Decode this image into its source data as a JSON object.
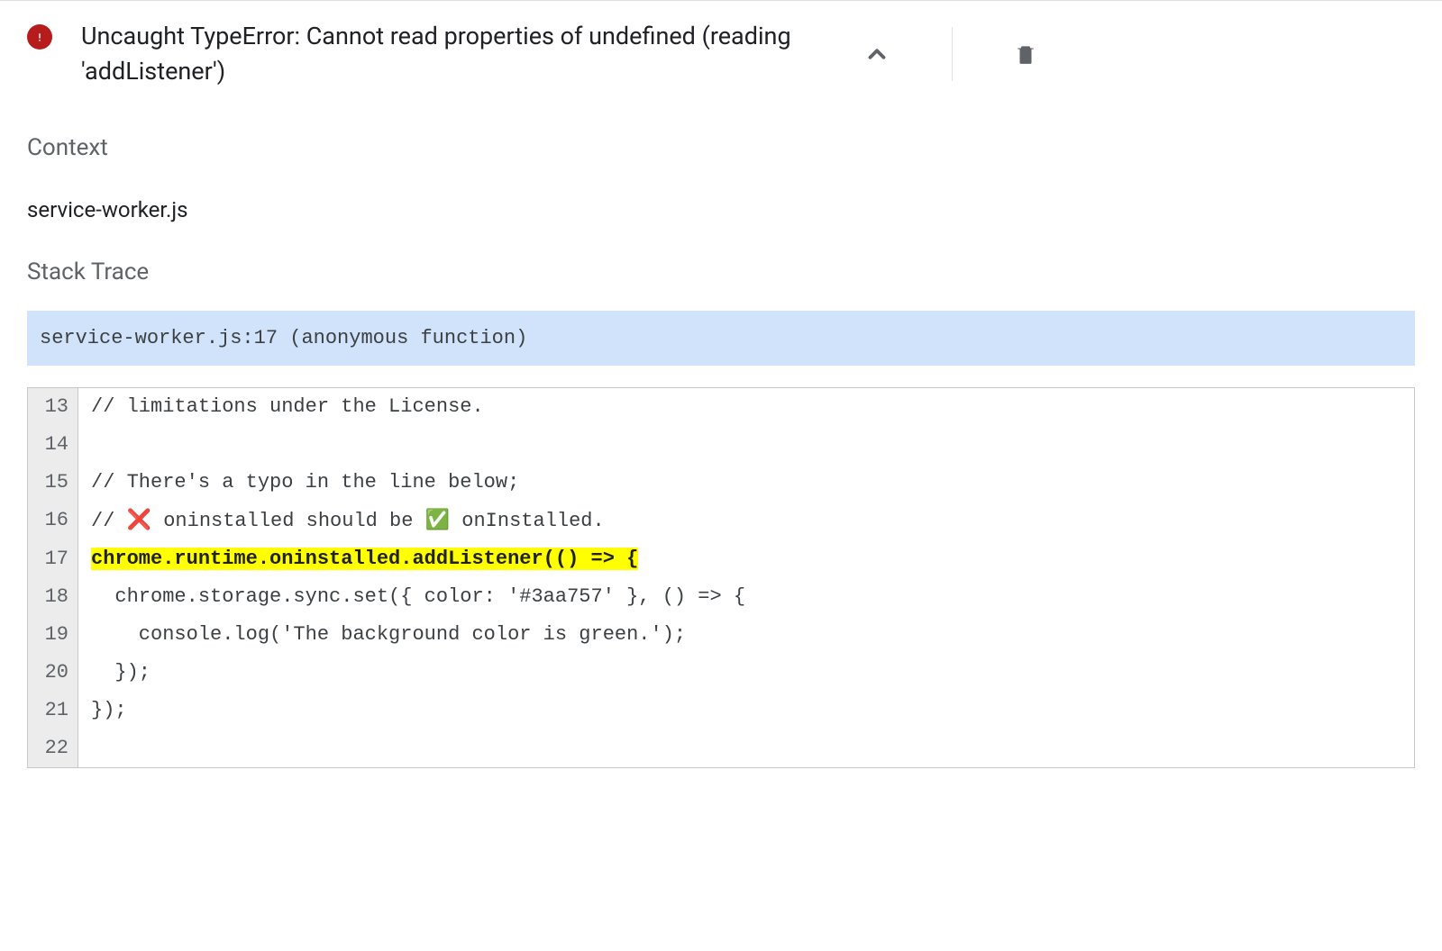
{
  "error": {
    "title": "Uncaught TypeError: Cannot read properties of undefined (reading 'addListener')"
  },
  "context": {
    "label": "Context",
    "value": "service-worker.js"
  },
  "stack_trace": {
    "label": "Stack Trace",
    "frame": "service-worker.js:17 (anonymous function)"
  },
  "code": {
    "highlighted_line": 17,
    "lines": [
      {
        "n": 13,
        "text": "// limitations under the License."
      },
      {
        "n": 14,
        "text": ""
      },
      {
        "n": 15,
        "text": "// There's a typo in the line below;"
      },
      {
        "n": 16,
        "prefix": "// ",
        "emoji1": "❌",
        "mid": " oninstalled should be ",
        "emoji2": "✅",
        "suffix": " onInstalled."
      },
      {
        "n": 17,
        "text": "chrome.runtime.oninstalled.addListener(() => {"
      },
      {
        "n": 18,
        "text": "  chrome.storage.sync.set({ color: '#3aa757' }, () => {"
      },
      {
        "n": 19,
        "text": "    console.log('The background color is green.');"
      },
      {
        "n": 20,
        "text": "  });"
      },
      {
        "n": 21,
        "text": "});"
      },
      {
        "n": 22,
        "text": ""
      }
    ]
  }
}
